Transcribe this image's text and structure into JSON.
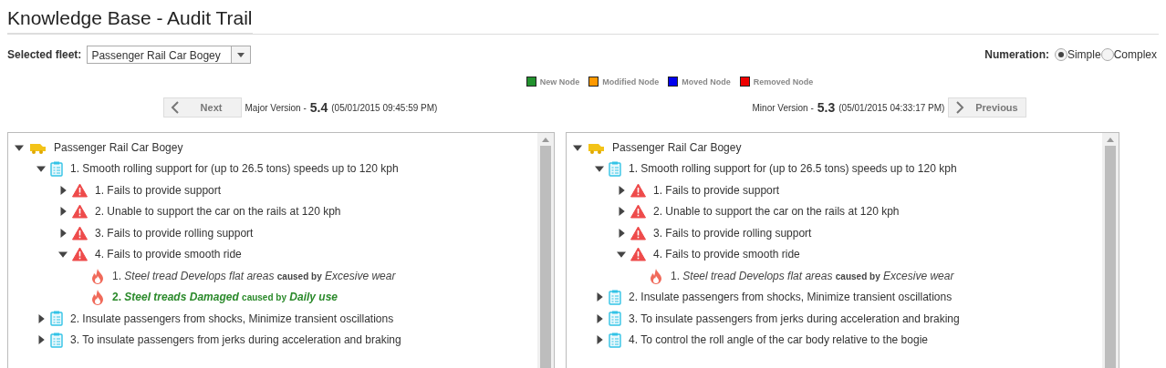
{
  "title": "Knowledge Base - Audit Trail",
  "fleet_select": {
    "label": "Selected fleet:",
    "value": "Passenger Rail Car Bogey"
  },
  "numeration": {
    "label": "Numeration:",
    "options": [
      {
        "label": "Simple",
        "selected": true
      },
      {
        "label": "Complex",
        "selected": false
      }
    ]
  },
  "legend": [
    {
      "label": "New Node",
      "color": "#22922e"
    },
    {
      "label": "Modified Node",
      "color": "#ff9900"
    },
    {
      "label": "Moved Node",
      "color": "#0000ee"
    },
    {
      "label": "Removed Node",
      "color": "#ee0000"
    }
  ],
  "panels": [
    {
      "button": {
        "kind": "next",
        "label": "Next"
      },
      "version_label": "Major Version -",
      "version": "5.4",
      "date": "(05/01/2015 09:45:59 PM)",
      "tree": [
        {
          "kind": "fleet",
          "text": "Passenger Rail Car Bogey",
          "expanded": true,
          "children": [
            {
              "kind": "function",
              "text": "1. Smooth rolling support for (up to 26.5 tons) speeds up to 120 kph",
              "expanded": true,
              "children": [
                {
                  "kind": "failure",
                  "text": "1. Fails to provide support",
                  "expanded": false
                },
                {
                  "kind": "failure",
                  "text": "2. Unable to support the car on the rails at 120 kph",
                  "expanded": false
                },
                {
                  "kind": "failure",
                  "text": "3. Fails to provide rolling support",
                  "expanded": false
                },
                {
                  "kind": "failure",
                  "text": "4. Fails to provide smooth ride",
                  "expanded": true,
                  "children": [
                    {
                      "kind": "cause",
                      "new": false,
                      "text": "1. *Steel tread Develops flat areas* **caused by** *Excesive wear*"
                    },
                    {
                      "kind": "cause",
                      "new": true,
                      "text": "2. *Steel treads Damaged* **caused by** *Daily use*"
                    }
                  ]
                }
              ]
            },
            {
              "kind": "function",
              "text": "2. Insulate passengers from shocks, Minimize transient oscillations",
              "expanded": false
            },
            {
              "kind": "function",
              "text": "3. To insulate passengers from jerks during acceleration and braking",
              "expanded": false
            }
          ]
        }
      ]
    },
    {
      "button": {
        "kind": "previous",
        "label": "Previous"
      },
      "version_label": "Minor Version -",
      "version": "5.3",
      "date": "(05/01/2015 04:33:17 PM)",
      "tree": [
        {
          "kind": "fleet",
          "text": "Passenger Rail Car Bogey",
          "expanded": true,
          "children": [
            {
              "kind": "function",
              "text": "1. Smooth rolling support for (up to 26.5 tons) speeds up to 120 kph",
              "expanded": true,
              "children": [
                {
                  "kind": "failure",
                  "text": "1. Fails to provide support",
                  "expanded": false
                },
                {
                  "kind": "failure",
                  "text": "2. Unable to support the car on the rails at 120 kph",
                  "expanded": false
                },
                {
                  "kind": "failure",
                  "text": "3. Fails to provide rolling support",
                  "expanded": false
                },
                {
                  "kind": "failure",
                  "text": "4. Fails to provide smooth ride",
                  "expanded": true,
                  "children": [
                    {
                      "kind": "cause",
                      "new": false,
                      "text": "1. *Steel tread Develops flat areas* **caused by** *Excesive wear*"
                    }
                  ]
                }
              ]
            },
            {
              "kind": "function",
              "text": "2. Insulate passengers from shocks, Minimize transient oscillations",
              "expanded": false
            },
            {
              "kind": "function",
              "text": "3. To insulate passengers from jerks during acceleration and braking",
              "expanded": false
            },
            {
              "kind": "function",
              "text": "4. To control the roll angle of the car body relative to the bogie",
              "expanded": false
            }
          ]
        }
      ]
    }
  ]
}
